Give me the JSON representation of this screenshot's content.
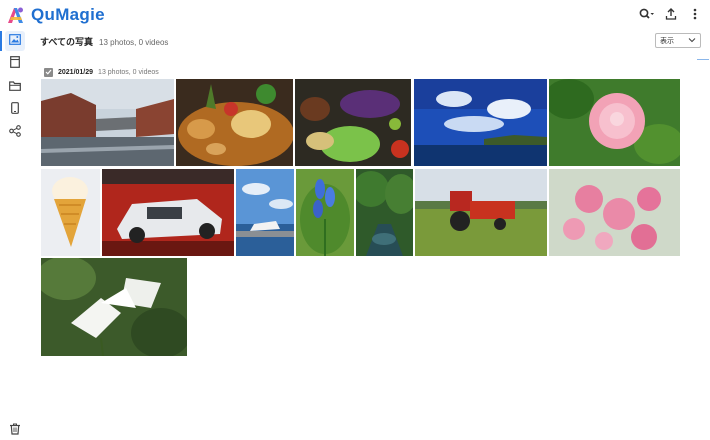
{
  "app": {
    "name": "QuMagie"
  },
  "top_actions": [
    "search-icon",
    "upload-icon",
    "more-icon"
  ],
  "sidebar": {
    "items": [
      {
        "name": "photos",
        "icon": "image-icon",
        "active": true
      },
      {
        "name": "albums",
        "icon": "album-icon",
        "active": false
      },
      {
        "name": "folders",
        "icon": "folder-icon",
        "active": false
      },
      {
        "name": "devices",
        "icon": "phone-icon",
        "active": false
      },
      {
        "name": "shared",
        "icon": "share-icon",
        "active": false
      }
    ],
    "bottom_icon": "trash-icon"
  },
  "header": {
    "title": "すべての写真",
    "count": "13 photos, 0 videos"
  },
  "view_select": {
    "label": "表示"
  },
  "group": {
    "date": "2021/01/29",
    "count": "13 photos, 0 videos",
    "checked": true
  },
  "photos": [
    {
      "subject": "brick warehouses by canal"
    },
    {
      "subject": "curry with vegetables"
    },
    {
      "subject": "grilled vegetables with eggplant"
    },
    {
      "subject": "blue sky over sea cliff"
    },
    {
      "subject": "pink camellia flower"
    },
    {
      "subject": "ice cream cone"
    },
    {
      "subject": "race car"
    },
    {
      "subject": "boats at harbor"
    },
    {
      "subject": "blue agapanthus flower"
    },
    {
      "subject": "forest stream"
    },
    {
      "subject": "red tractor in field"
    },
    {
      "subject": "pink cherry blossoms"
    },
    {
      "subject": "white cyclamen flowers"
    }
  ],
  "colors": {
    "brand": "#1f6fd0",
    "accent": "#2a7ae2"
  }
}
